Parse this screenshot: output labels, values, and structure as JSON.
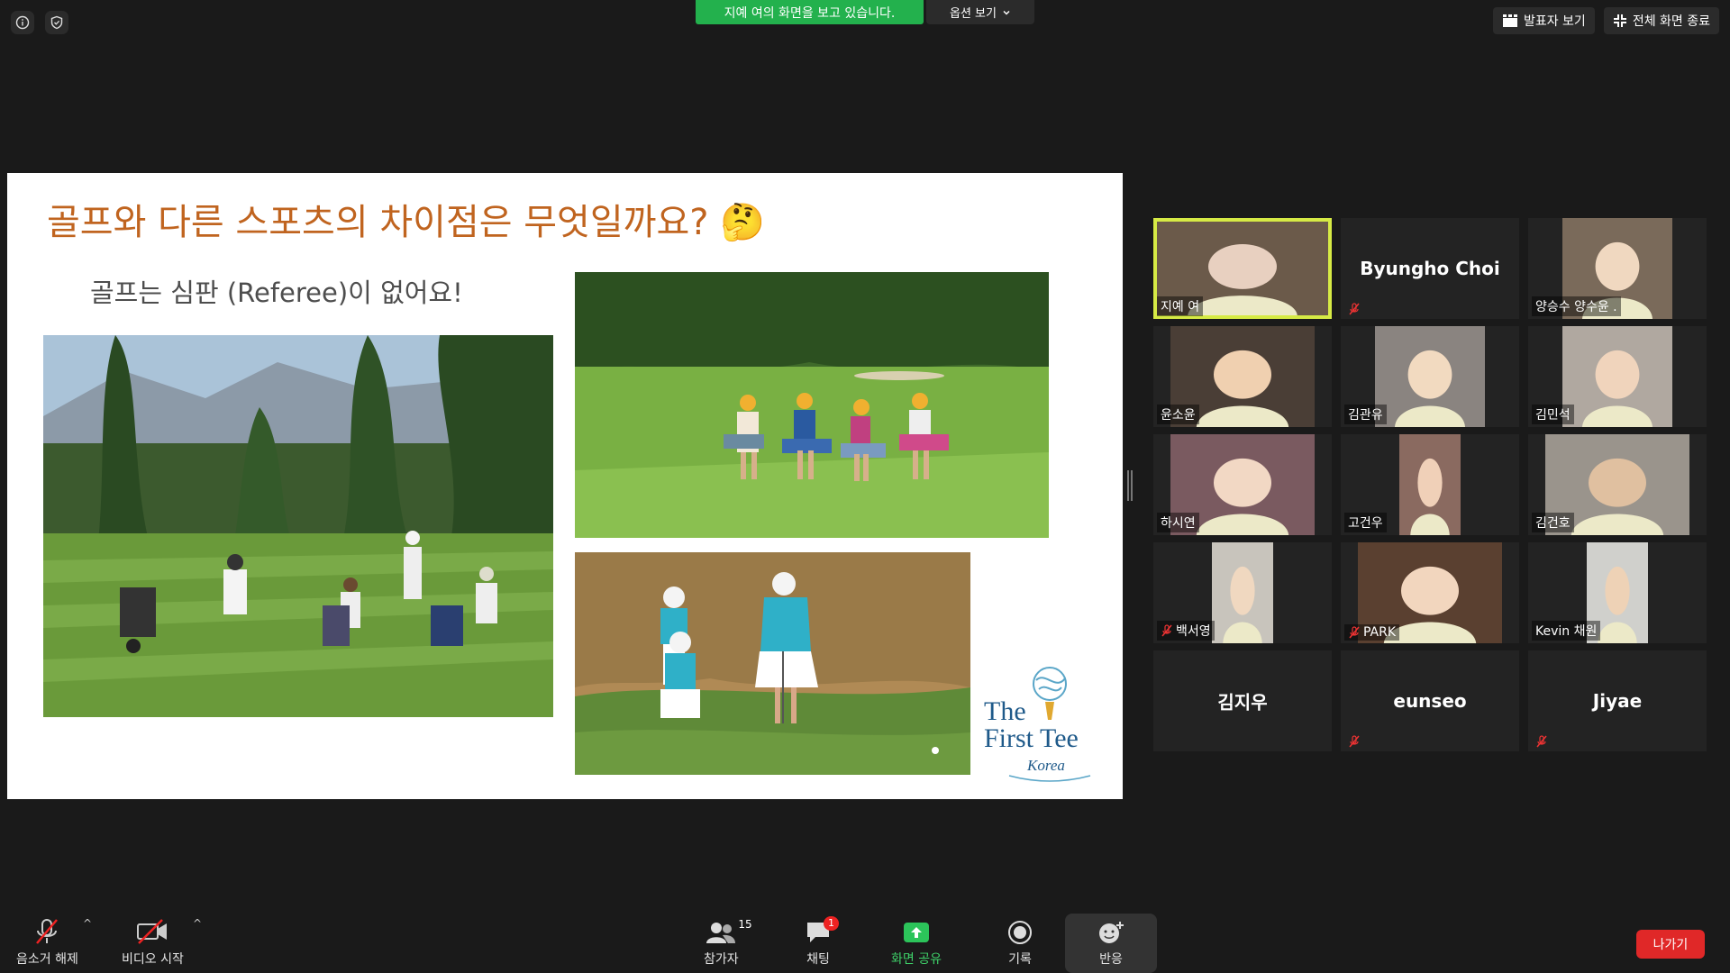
{
  "top": {
    "sharing_banner": "지예 여의 화면을 보고 있습니다.",
    "options_label": "옵션 보기",
    "speaker_view_label": "발표자 보기",
    "exit_fullscreen_label": "전체 화면 종료"
  },
  "slide": {
    "title": "골프와 다른 스포츠의 차이점은 무엇일까요? 🤔",
    "subtitle": "골프는 심판 (Referee)이 없어요!",
    "logo": {
      "line1": "The",
      "line2": "First Tee",
      "line3": "Korea"
    }
  },
  "gallery": [
    {
      "name": "지예 여",
      "muted": false,
      "video": true,
      "active": true
    },
    {
      "name": "Byungho Choi",
      "muted": true,
      "video": false
    },
    {
      "name": "양승수 양수윤 .",
      "muted": false,
      "video": true
    },
    {
      "name": "윤소윤",
      "muted": false,
      "video": true
    },
    {
      "name": "김관유",
      "muted": false,
      "video": true
    },
    {
      "name": "김민석",
      "muted": false,
      "video": true
    },
    {
      "name": "하시연",
      "muted": false,
      "video": true
    },
    {
      "name": "고건우",
      "muted": false,
      "video": true
    },
    {
      "name": "김건호",
      "muted": false,
      "video": true
    },
    {
      "name": "백서영",
      "muted": true,
      "video": true
    },
    {
      "name": "PARK",
      "muted": true,
      "video": true
    },
    {
      "name": "Kevin 채원",
      "muted": false,
      "video": true
    },
    {
      "name": "김지우",
      "muted": false,
      "video": false
    },
    {
      "name": "eunseo",
      "muted": true,
      "video": false
    },
    {
      "name": "Jiyae",
      "muted": true,
      "video": false
    }
  ],
  "toolbar": {
    "unmute_label": "음소거 해제",
    "start_video_label": "비디오 시작",
    "participants_label": "참가자",
    "participants_count": "15",
    "chat_label": "채팅",
    "chat_badge": "1",
    "share_screen_label": "화면 공유",
    "record_label": "기록",
    "reactions_label": "반응",
    "leave_label": "나가기"
  },
  "colors": {
    "share_green": "#23b14d",
    "active_speaker": "#d6ea45",
    "leave_red": "#e02828",
    "title_orange": "#c0641f"
  }
}
